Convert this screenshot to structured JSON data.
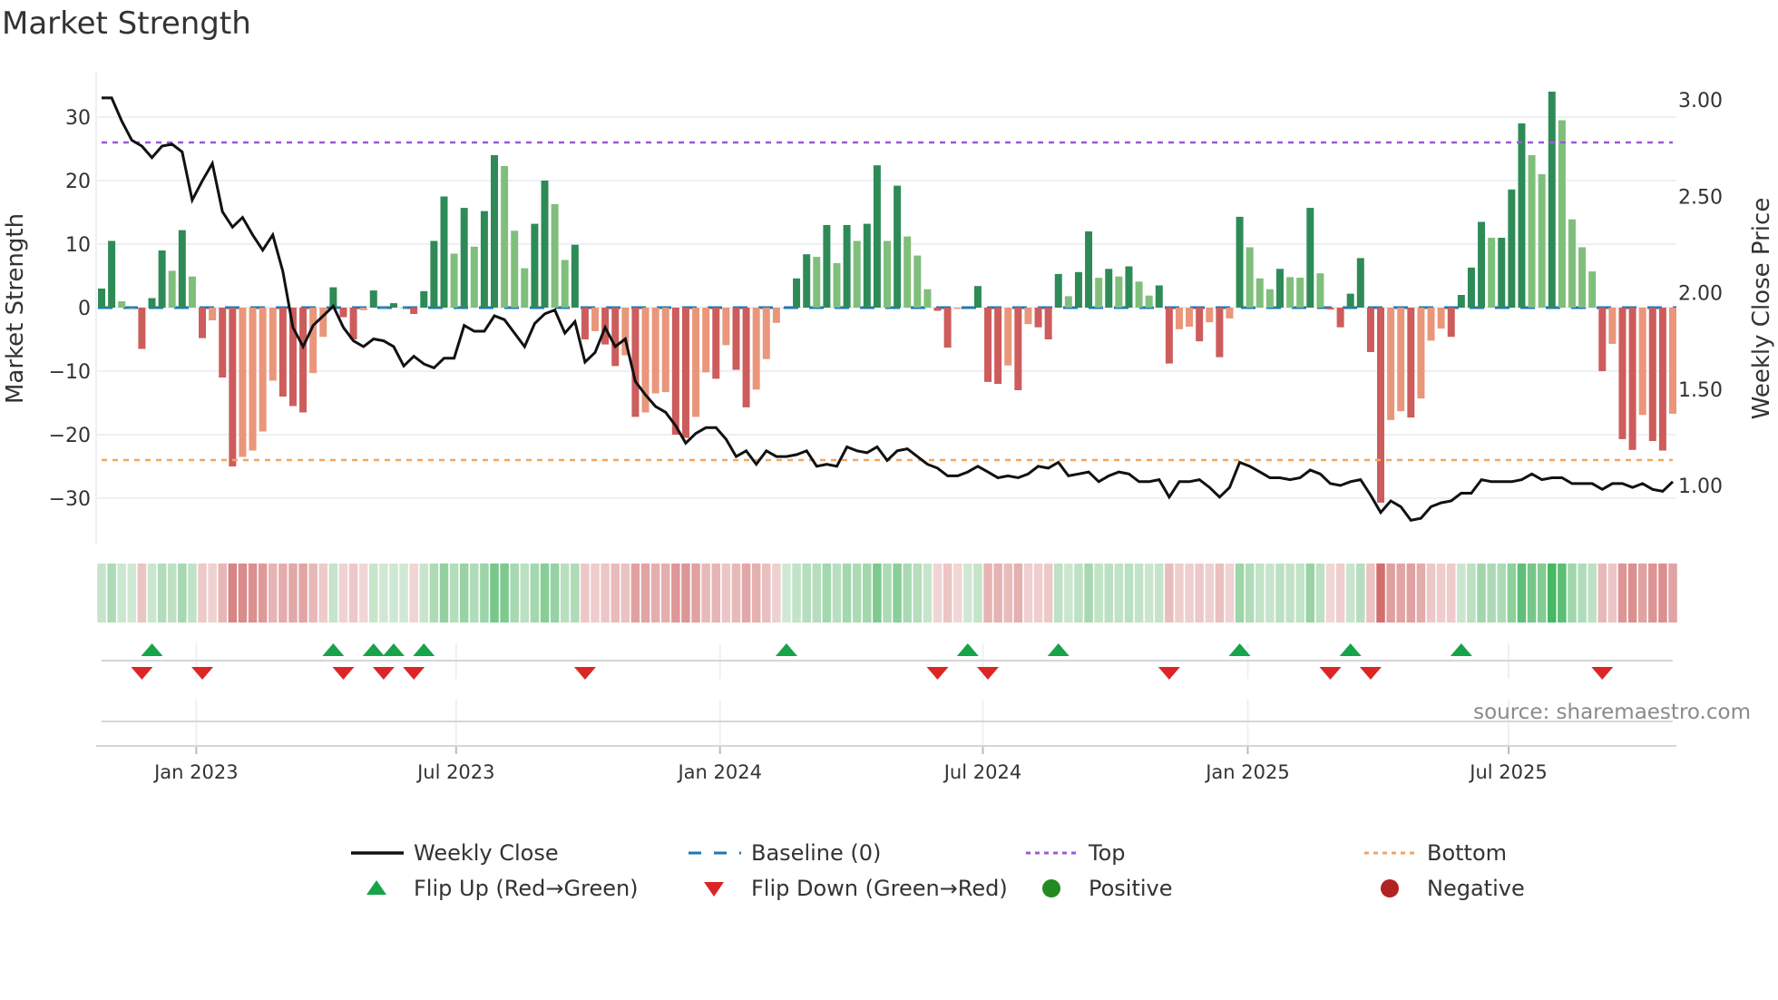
{
  "title": "Market Strength",
  "chart_data": {
    "type": "bar+line",
    "title": "Market Strength",
    "ylabel_left": "Market Strength",
    "ylabel_right": "Weekly Close Price",
    "ylim_left": [
      -37.5,
      35
    ],
    "ylim_right": [
      0.75,
      3.1
    ],
    "yticks_left": [
      30,
      20,
      10,
      0,
      -10,
      -20,
      -30
    ],
    "yticks_left_labels": [
      "30",
      "20",
      "10",
      "0",
      "−10",
      "−20",
      "−30"
    ],
    "yticks_right": [
      3.0,
      2.5,
      2.0,
      1.5,
      1.0
    ],
    "yticks_right_labels": [
      "3.00",
      "2.50",
      "2.00",
      "1.50",
      "1.00"
    ],
    "xticks": [
      {
        "week": 9.4,
        "label": "Jan 2023"
      },
      {
        "week": 35.2,
        "label": "Jul 2023"
      },
      {
        "week": 61.4,
        "label": "Jan 2024"
      },
      {
        "week": 87.5,
        "label": "Jul 2024"
      },
      {
        "week": 113.8,
        "label": "Jan 2025"
      },
      {
        "week": 139.7,
        "label": "Jul 2025"
      }
    ],
    "top_level": 26,
    "bottom_level": -24,
    "baseline": 0,
    "strength": [
      3,
      10.5,
      1,
      0,
      -6.5,
      1.5,
      9,
      5.8,
      12.2,
      4.9,
      -4.8,
      -2,
      -11,
      -25,
      -23.5,
      -22.5,
      -19.5,
      -11.5,
      -14,
      -15.5,
      -16.5,
      -10.3,
      -4.6,
      3.2,
      -1.5,
      -5,
      -0.4,
      2.7,
      0,
      0.7,
      0,
      -1,
      2.6,
      10.5,
      17.5,
      8.5,
      15.7,
      9.6,
      15.2,
      24,
      22.3,
      12.1,
      6.2,
      13.2,
      20,
      16.3,
      7.5,
      9.9,
      -5,
      -3.7,
      -5.8,
      -9.2,
      -7.5,
      -17.2,
      -16.5,
      -13.5,
      -13.3,
      -20,
      -20.5,
      -17.2,
      -10.2,
      -11.2,
      -5.9,
      -9.8,
      -15.7,
      -12.9,
      -8.1,
      -2.4,
      0,
      4.6,
      8.4,
      8,
      13,
      7,
      13,
      10.5,
      13.2,
      22.4,
      10.5,
      19.2,
      11.2,
      8.2,
      2.9,
      -0.5,
      -6.3,
      -0.2,
      0,
      3.4,
      -11.7,
      -12,
      -9.1,
      -13,
      -2.6,
      -3.1,
      -5,
      5.3,
      1.8,
      5.6,
      12,
      4.7,
      6.1,
      4.9,
      6.5,
      4.1,
      1.9,
      3.5,
      -8.8,
      -3.4,
      -3,
      -5.3,
      -2.3,
      -7.8,
      -1.7,
      14.3,
      9.5,
      4.6,
      2.9,
      6.1,
      4.8,
      4.7,
      15.7,
      5.4,
      -0.3,
      -3.1,
      2.2,
      7.8,
      -7,
      -30.7,
      -17.7,
      -16.3,
      -17.3,
      -14.3,
      -5.2,
      -3.3,
      -4.6,
      2,
      6.3,
      13.5,
      11,
      11,
      18.6,
      29,
      24,
      21,
      34,
      29.5,
      13.9,
      9.5,
      5.7,
      -10,
      -5.7,
      -20.7,
      -22.4,
      -16.9,
      -21,
      -22.5,
      -16.7
    ],
    "weekly_close": [
      3.01,
      3.01,
      2.89,
      2.79,
      2.76,
      2.7,
      2.76,
      2.77,
      2.73,
      2.48,
      2.58,
      2.67,
      2.42,
      2.34,
      2.39,
      2.3,
      2.22,
      2.3,
      2.11,
      1.82,
      1.72,
      1.83,
      1.88,
      1.93,
      1.82,
      1.75,
      1.72,
      1.76,
      1.75,
      1.72,
      1.62,
      1.67,
      1.63,
      1.61,
      1.66,
      1.66,
      1.83,
      1.8,
      1.8,
      1.88,
      1.86,
      1.79,
      1.72,
      1.84,
      1.89,
      1.91,
      1.79,
      1.85,
      1.64,
      1.69,
      1.82,
      1.72,
      1.76,
      1.54,
      1.47,
      1.41,
      1.38,
      1.31,
      1.22,
      1.27,
      1.3,
      1.3,
      1.24,
      1.15,
      1.18,
      1.11,
      1.18,
      1.15,
      1.15,
      1.16,
      1.18,
      1.1,
      1.11,
      1.1,
      1.2,
      1.18,
      1.17,
      1.2,
      1.13,
      1.18,
      1.19,
      1.15,
      1.11,
      1.09,
      1.05,
      1.05,
      1.07,
      1.1,
      1.07,
      1.04,
      1.05,
      1.04,
      1.06,
      1.1,
      1.09,
      1.12,
      1.05,
      1.06,
      1.07,
      1.02,
      1.05,
      1.07,
      1.06,
      1.02,
      1.02,
      1.03,
      0.94,
      1.02,
      1.02,
      1.03,
      0.99,
      0.94,
      0.99,
      1.12,
      1.1,
      1.07,
      1.04,
      1.04,
      1.03,
      1.04,
      1.08,
      1.06,
      1.01,
      1.0,
      1.02,
      1.03,
      0.95,
      0.86,
      0.92,
      0.89,
      0.82,
      0.83,
      0.89,
      0.91,
      0.92,
      0.96,
      0.96,
      1.03,
      1.02,
      1.02,
      1.02,
      1.03,
      1.06,
      1.03,
      1.04,
      1.04,
      1.01,
      1.01,
      1.01,
      0.98,
      1.01,
      1.01,
      0.99,
      1.01,
      0.98,
      0.97,
      1.02
    ],
    "flip_up_weeks": [
      5,
      23,
      27,
      29,
      32,
      68,
      86,
      95,
      113,
      124,
      135
    ],
    "flip_down_weeks": [
      4,
      10,
      24,
      28,
      31,
      48,
      83,
      88,
      106,
      122,
      126,
      149
    ],
    "legend_placement": "bottom",
    "legend": [
      {
        "label": "Weekly Close",
        "kind": "line-solid",
        "color": "#111111"
      },
      {
        "label": "Baseline (0)",
        "kind": "line-dash",
        "color": "#1f77b4"
      },
      {
        "label": "Top",
        "kind": "line-dot",
        "color": "#9b59d6"
      },
      {
        "label": "Bottom",
        "kind": "line-dot",
        "color": "#f4a460"
      },
      {
        "label": "Flip Up (Red→Green)",
        "kind": "triangle-up",
        "color": "#16a34a"
      },
      {
        "label": "Flip Down (Green→Red)",
        "kind": "triangle-down",
        "color": "#dc2626"
      },
      {
        "label": "Positive",
        "kind": "dot",
        "color": "#228b22"
      },
      {
        "label": "Negative",
        "kind": "dot",
        "color": "#b22222"
      }
    ],
    "source": "source: sharemaestro.com"
  },
  "colors": {
    "pos_strong": "#2e8b57",
    "pos_weak": "#7fbf7b",
    "neg_strong": "#cd5c5c",
    "neg_weak": "#e9967a",
    "top": "#9b59d6",
    "bottom": "#f4a460",
    "baseline": "#1f77b4",
    "line": "#111111"
  }
}
